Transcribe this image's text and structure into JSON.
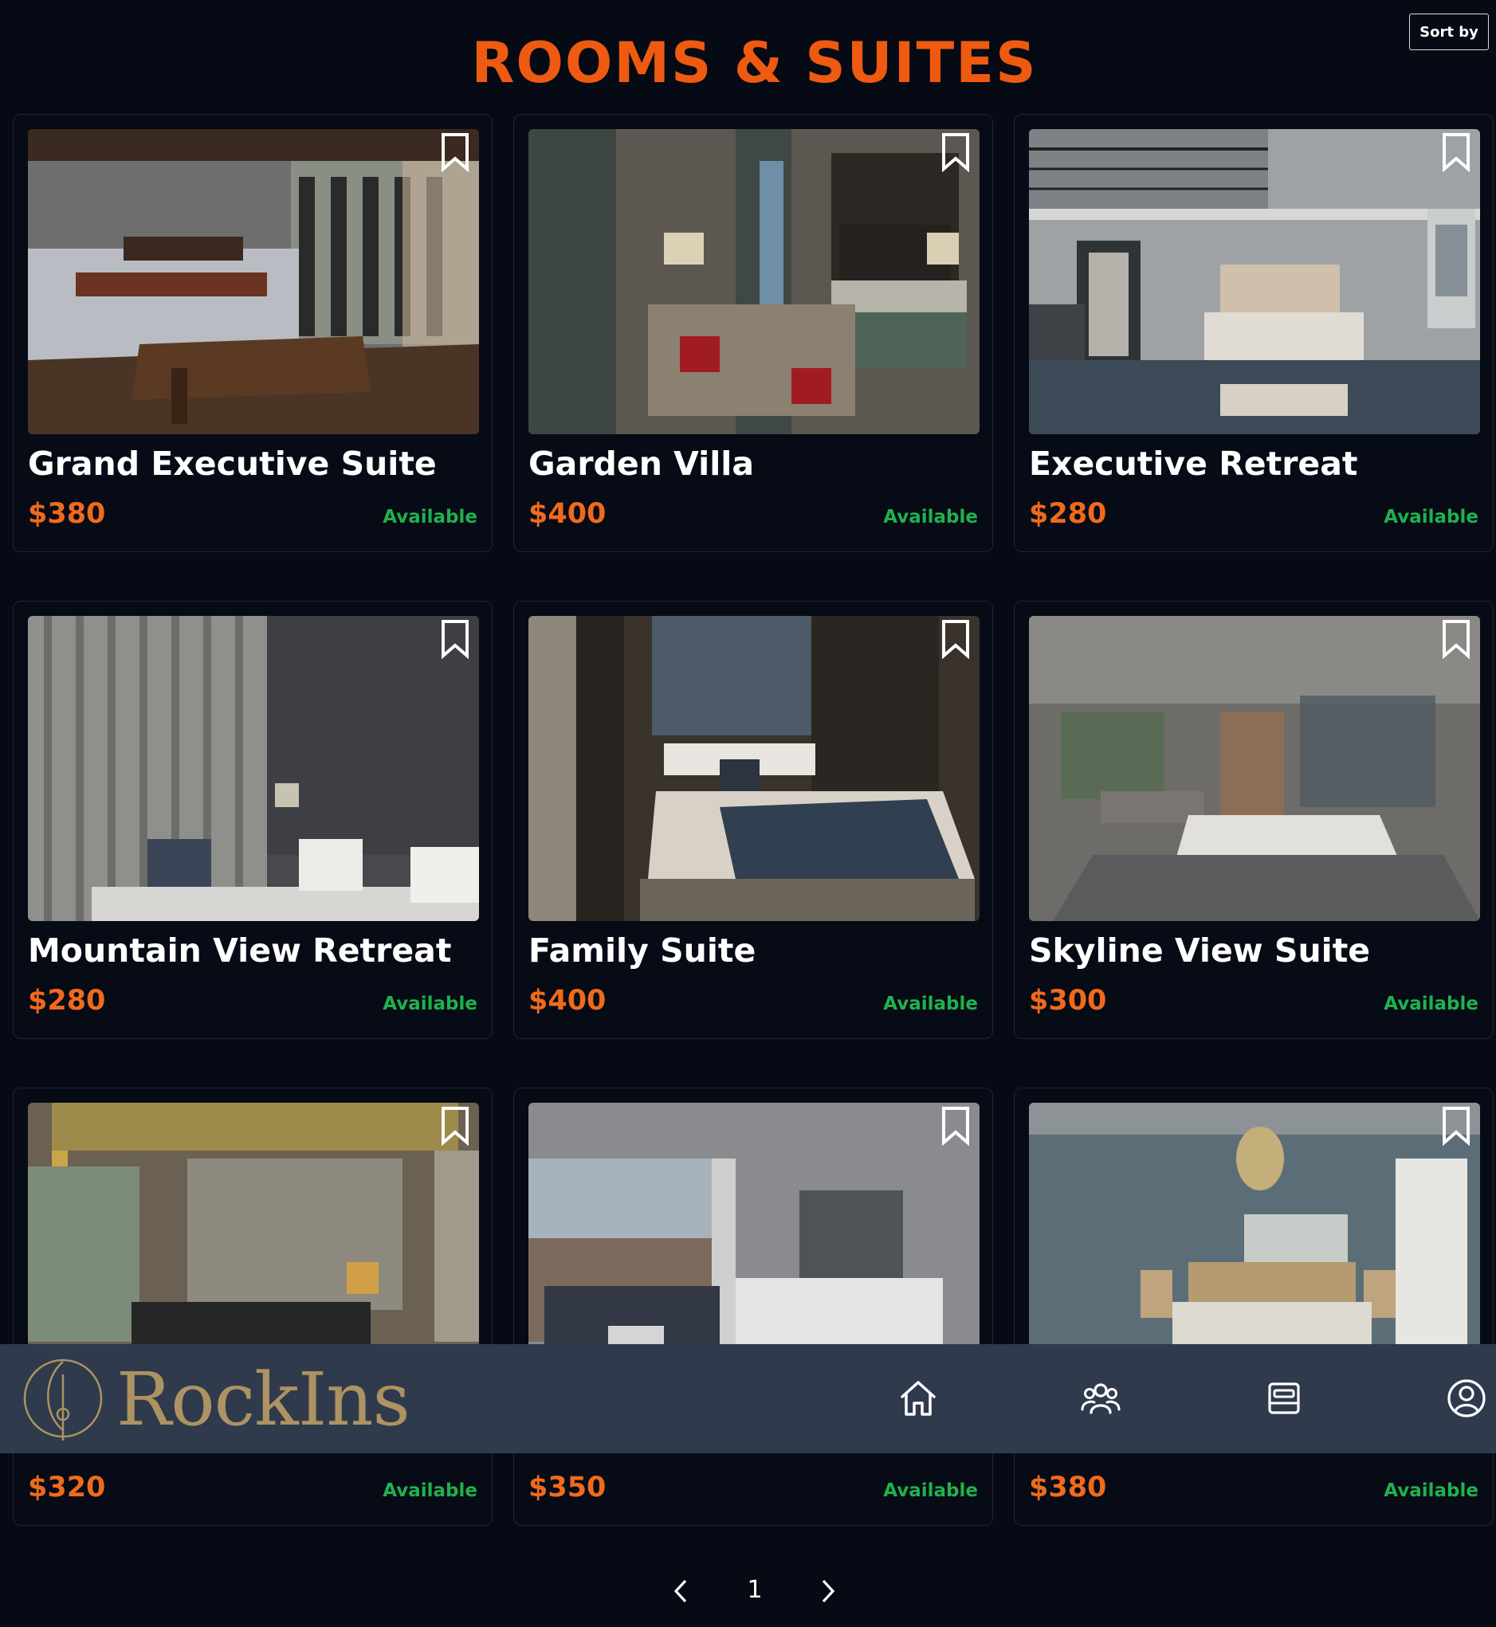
{
  "header": {
    "title": "ROOMS & SUITES",
    "sort_label": "Sort by"
  },
  "rooms": [
    {
      "name": "Grand Executive Suite",
      "price": "$380",
      "status": "Available"
    },
    {
      "name": "Garden Villa",
      "price": "$400",
      "status": "Available"
    },
    {
      "name": "Executive Retreat",
      "price": "$280",
      "status": "Available"
    },
    {
      "name": "Mountain View Retreat",
      "price": "$280",
      "status": "Available"
    },
    {
      "name": "Family Suite",
      "price": "$400",
      "status": "Available"
    },
    {
      "name": "Skyline View Suite",
      "price": "$300",
      "status": "Available"
    },
    {
      "name": "",
      "price": "$320",
      "status": "Available"
    },
    {
      "name": "",
      "price": "$350",
      "status": "Available"
    },
    {
      "name": "",
      "price": "$380",
      "status": "Available"
    }
  ],
  "footer": {
    "brand": "RockIns",
    "nav": [
      "home-icon",
      "users-icon",
      "bed-icon",
      "profile-icon"
    ]
  },
  "pagination": {
    "current_page": "1"
  },
  "colors": {
    "accent": "#ee5a10",
    "price": "#f06a1c",
    "available": "#1fb24c",
    "background": "#050a14",
    "footer": "#2f3a4d",
    "brand_gold": "#ad9262"
  }
}
